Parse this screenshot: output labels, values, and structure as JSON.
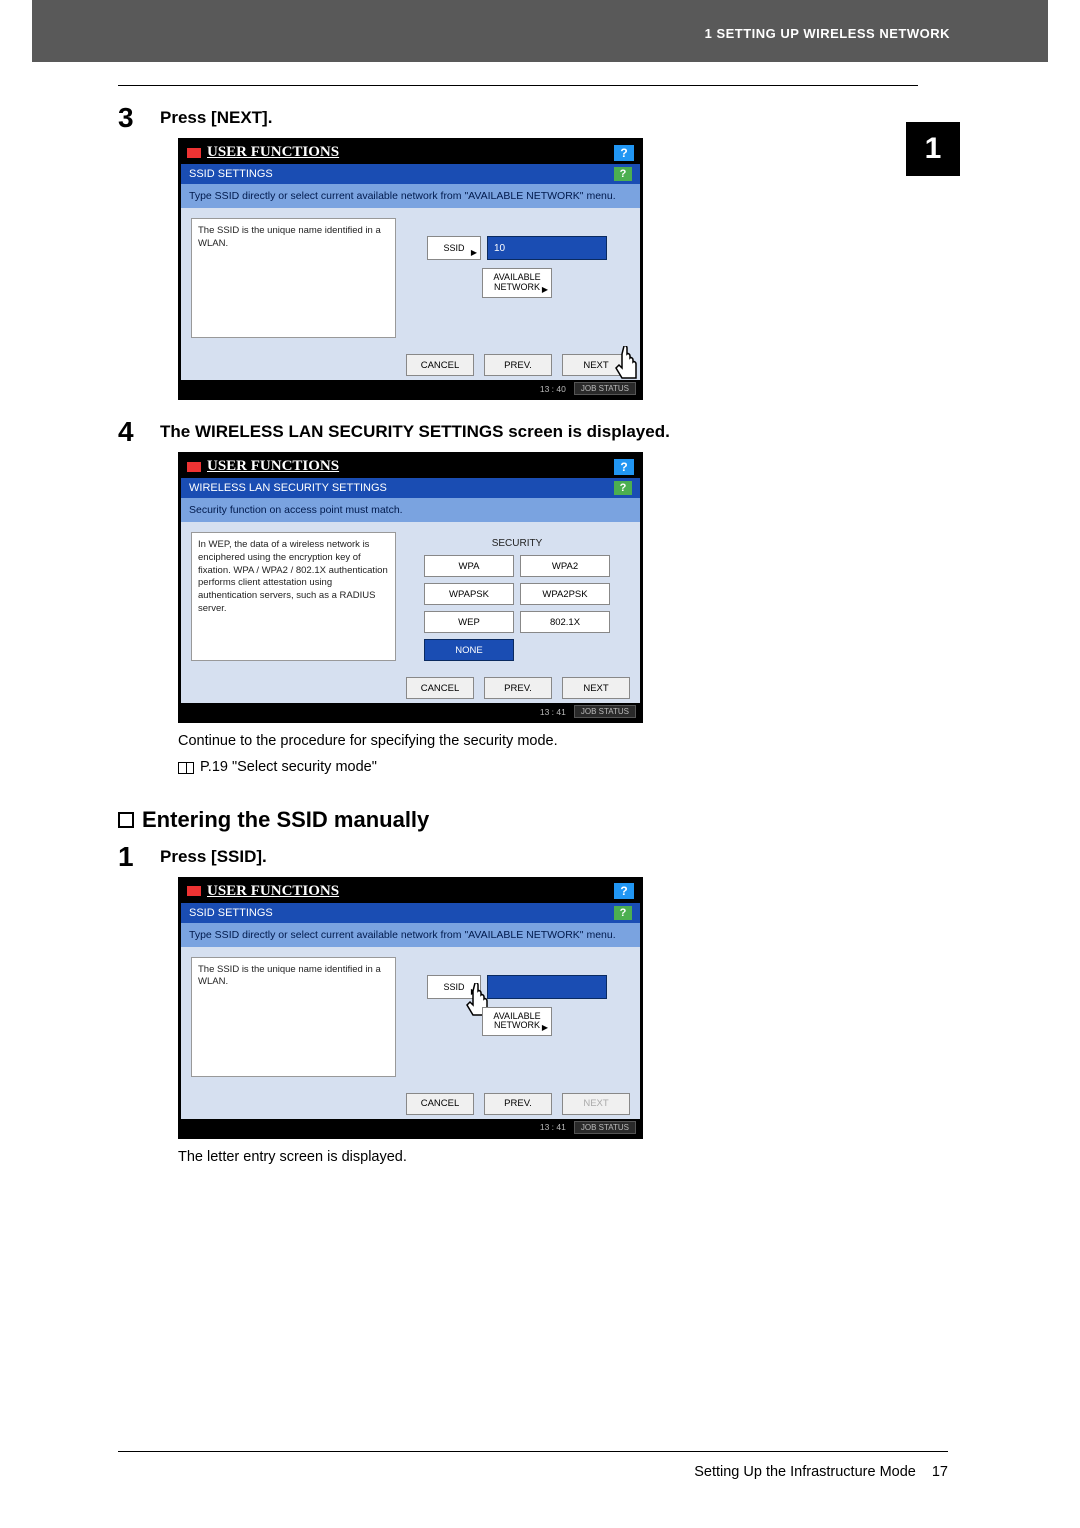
{
  "header": {
    "banner": "1 SETTING UP WIRELESS NETWORK",
    "chapter_tab": "1"
  },
  "steps": {
    "s3": {
      "num": "3",
      "title": "Press [NEXT].",
      "screen": {
        "title": "USER FUNCTIONS",
        "subtitle": "SSID SETTINGS",
        "instruction": "Type SSID directly or select current available network from \"AVAILABLE NETWORK\" menu.",
        "left_text": "The SSID is the unique name identified in a WLAN.",
        "ssid_label": "SSID",
        "ssid_value": "10",
        "avail_label": "AVAILABLE NETWORK",
        "cancel": "CANCEL",
        "prev": "PREV.",
        "next": "NEXT",
        "time": "13 : 40",
        "status": "JOB STATUS"
      }
    },
    "s4": {
      "num": "4",
      "title": "The WIRELESS LAN SECURITY SETTINGS screen is displayed.",
      "screen": {
        "title": "USER FUNCTIONS",
        "subtitle": "WIRELESS LAN SECURITY SETTINGS",
        "instruction": "Security function on access point must match.",
        "left_text": "In WEP, the data of a wireless network is enciphered using the encryption key of fixation. WPA / WPA2 / 802.1X authentication performs client attestation using authentication servers, such as a RADIUS server.",
        "sec_label": "SECURITY",
        "buttons": {
          "wpa": "WPA",
          "wpa2": "WPA2",
          "wpapsk": "WPAPSK",
          "wpa2psk": "WPA2PSK",
          "wep": "WEP",
          "x8021": "802.1X",
          "none": "NONE"
        },
        "cancel": "CANCEL",
        "prev": "PREV.",
        "next": "NEXT",
        "time": "13 : 41",
        "status": "JOB STATUS"
      },
      "after1": "Continue to the procedure for specifying the security mode.",
      "after2": "P.19 \"Select security mode\""
    }
  },
  "section2": {
    "heading": "Entering the SSID manually",
    "s1": {
      "num": "1",
      "title": "Press [SSID].",
      "screen": {
        "title": "USER FUNCTIONS",
        "subtitle": "SSID SETTINGS",
        "instruction": "Type SSID directly or select current available network from \"AVAILABLE NETWORK\" menu.",
        "left_text": "The SSID is the unique name identified in a WLAN.",
        "ssid_label": "SSID",
        "ssid_value": "",
        "avail_label": "AVAILABLE NETWORK",
        "cancel": "CANCEL",
        "prev": "PREV.",
        "next": "NEXT",
        "time": "13 : 41",
        "status": "JOB STATUS"
      },
      "after": "The letter entry screen is displayed."
    }
  },
  "footer": {
    "text": "Setting Up the Infrastructure Mode",
    "page": "17"
  }
}
